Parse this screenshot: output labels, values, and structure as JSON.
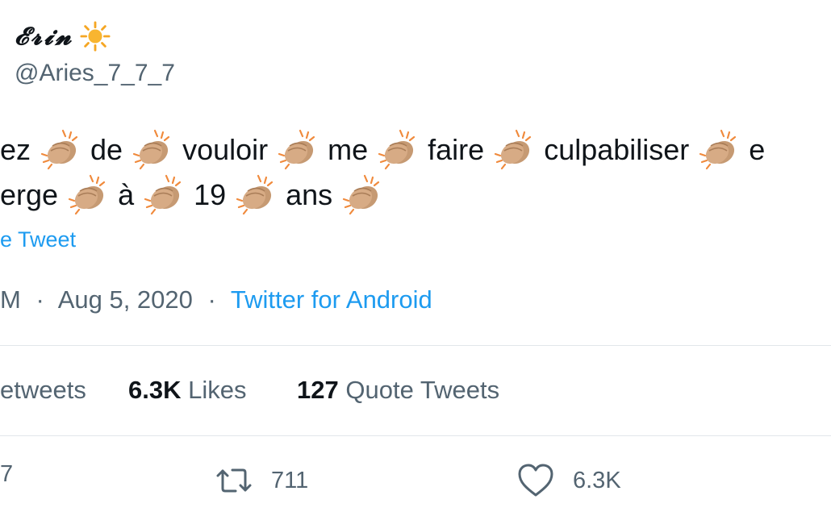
{
  "author": {
    "display_name": "𝓔𝓻𝓲𝓷",
    "handle": "@Aries_7_7_7",
    "name_icon": "sun-icon"
  },
  "tweet": {
    "line1": [
      "ez",
      "de",
      "vouloir",
      "me",
      "faire",
      "culpabiliser",
      "e"
    ],
    "line2": [
      "erge",
      "à",
      "19",
      "ans"
    ],
    "emoji_icon": "clapping-hands-icon",
    "translate_label": "e Tweet"
  },
  "meta": {
    "time": "M",
    "separator": "·",
    "date": "Aug 5, 2020",
    "source": "Twitter for Android"
  },
  "stats": {
    "retweets_label": "etweets",
    "likes_count": "6.3K",
    "likes_label": "Likes",
    "quotes_count": "127",
    "quotes_label": "Quote Tweets"
  },
  "actions": {
    "reply_count": "7",
    "retweet_count": "711",
    "like_count": "6.3K"
  },
  "colors": {
    "link": "#1d9bf0",
    "secondary_text": "#536471",
    "primary_text": "#0f1419",
    "divider": "#e1e6ea"
  }
}
